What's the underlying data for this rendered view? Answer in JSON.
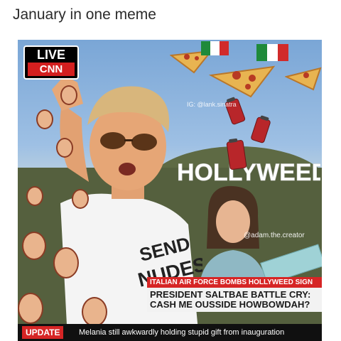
{
  "caption": "January in one meme",
  "live_badge": {
    "top": "LIVE",
    "bottom": "CNN"
  },
  "watermarks": {
    "instagram": "IG: @lank.sinatra",
    "creator": "@adam.the.creator"
  },
  "sign_text": "HOLLYWEED",
  "shirt_text": {
    "line1": "SEND",
    "line2": "NUDES"
  },
  "lower_third": {
    "banner": "ITALIAN AIR FORCE BOMBS HOLLYWEED SIGN",
    "headline_line1": "PRESIDENT SALTBAE BATTLE CRY:",
    "headline_line2": "CASH ME OUSSIDE HOWBOWDAH?"
  },
  "ticker": {
    "tag": "UPDATE",
    "text": "Melania still awkwardly holding stupid gift from inauguration"
  },
  "colors": {
    "cnn_red": "#d62525",
    "sky": "#9ec0e4",
    "hill": "#55603e"
  }
}
